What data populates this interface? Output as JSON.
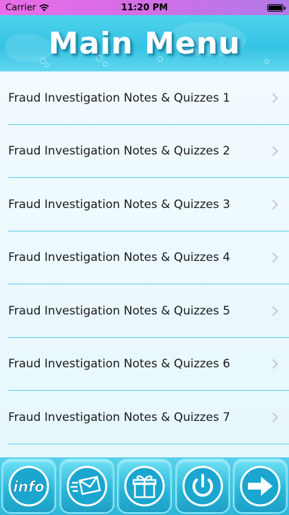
{
  "status_bar": {
    "carrier": "Carrier",
    "time": "11:20 PM"
  },
  "header": {
    "title": "Main Menu"
  },
  "menu": {
    "items": [
      {
        "label": "Fraud Investigation Notes & Quizzes 1"
      },
      {
        "label": "Fraud Investigation Notes & Quizzes 2"
      },
      {
        "label": "Fraud Investigation Notes & Quizzes 3"
      },
      {
        "label": "Fraud Investigation Notes & Quizzes 4"
      },
      {
        "label": "Fraud Investigation Notes & Quizzes 5"
      },
      {
        "label": "Fraud Investigation Notes & Quizzes 6"
      },
      {
        "label": "Fraud Investigation Notes & Quizzes 7"
      }
    ]
  },
  "toolbar": {
    "info_label": "info",
    "icons": [
      "info-icon",
      "mail-icon",
      "gift-icon",
      "power-icon",
      "arrow-right-icon"
    ]
  },
  "colors": {
    "header": "#35c4e4",
    "divider": "#4ed0e8",
    "status_bar": "#d96ce6"
  }
}
